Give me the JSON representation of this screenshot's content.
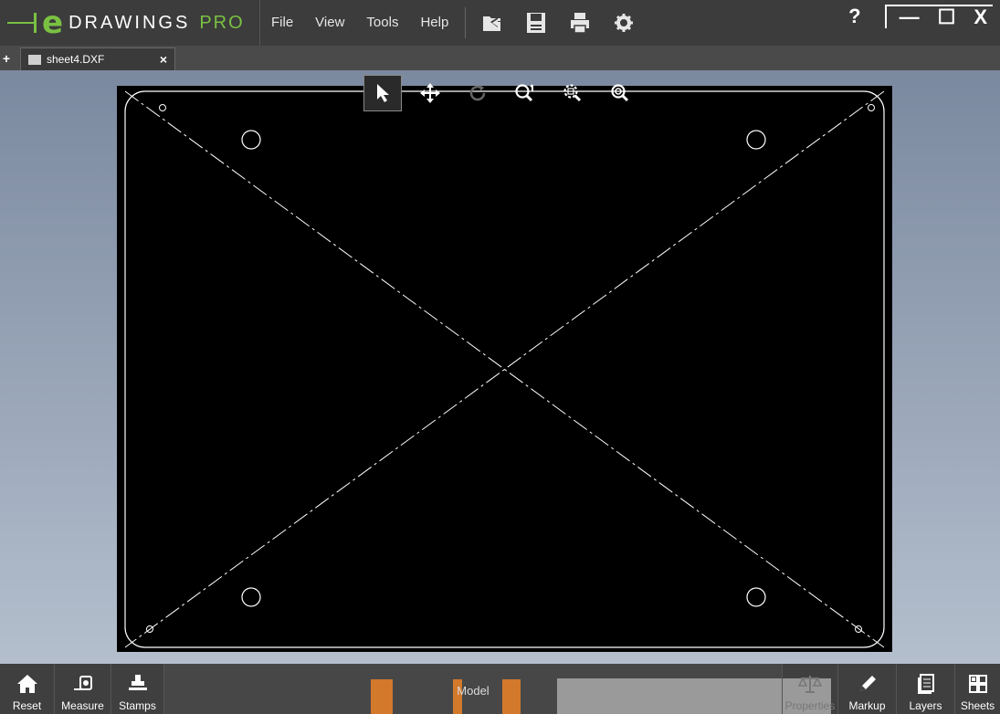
{
  "app": {
    "logo_letter": "e",
    "logo_word": "DRAWINGS",
    "logo_suffix": "PRO",
    "logo_accent_color": "#7ac142"
  },
  "menu": {
    "items": [
      {
        "label": "File"
      },
      {
        "label": "View"
      },
      {
        "label": "Tools"
      },
      {
        "label": "Help"
      }
    ]
  },
  "toolbar_icons": [
    "open-icon",
    "save-icon",
    "print-icon",
    "settings-icon"
  ],
  "window": {
    "help": "?",
    "minimize": "—",
    "maximize": "☐",
    "close": "X"
  },
  "tabs": [
    {
      "label": "sheet4.DXF",
      "close": "×"
    }
  ],
  "view_tools": [
    "select-icon",
    "pan-icon",
    "rotate-icon",
    "zoom-to-fit-icon",
    "zoom-to-area-icon",
    "zoom-icon"
  ],
  "bottom": {
    "left_buttons": [
      {
        "label": "Reset",
        "icon": "home-icon"
      },
      {
        "label": "Measure",
        "icon": "measure-icon"
      },
      {
        "label": "Stamps",
        "icon": "stamp-icon"
      }
    ],
    "model_label": "Model",
    "right_buttons": [
      {
        "label": "Properties",
        "icon": "scale-icon",
        "disabled": true
      },
      {
        "label": "Markup",
        "icon": "pencil-icon",
        "disabled": false
      },
      {
        "label": "Layers",
        "icon": "layers-icon",
        "disabled": false
      },
      {
        "label": "Sheets",
        "icon": "sheets-icon",
        "disabled": false
      }
    ]
  }
}
